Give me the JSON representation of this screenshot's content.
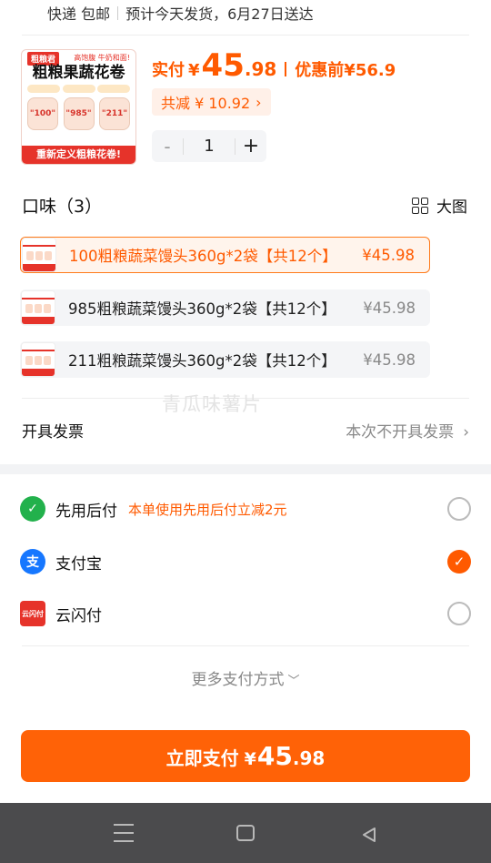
{
  "shipping": {
    "method": "快递 包邮",
    "estimate": "预计今天发货，6月27日送达"
  },
  "product": {
    "image": {
      "brand": "粗粮君",
      "tag": "高饱腹 牛奶和面!",
      "title": "粗粮果蔬花卷",
      "buns": [
        "\"100\"",
        "\"985\"",
        "\"211\""
      ],
      "footer": "重新定义粗粮花卷!"
    },
    "price_label": "实付",
    "price_currency": "¥",
    "price_int": "45",
    "price_dec": ".98",
    "orig_label": "优惠前",
    "orig_price": "¥56.9",
    "discount": "共减 ¥ 10.92",
    "quantity": "1",
    "minus": "-",
    "plus": "+"
  },
  "flavor": {
    "title": "口味（3）",
    "bigview": "大图",
    "options": [
      {
        "name": "100粗粮蔬菜馒头360g*2袋【共12个】",
        "price": "¥45.98"
      },
      {
        "name": "985粗粮蔬菜馒头360g*2袋【共12个】",
        "price": "¥45.98"
      },
      {
        "name": "211粗粮蔬菜馒头360g*2袋【共12个】",
        "price": "¥45.98"
      }
    ]
  },
  "watermark": "青瓜味薯片",
  "invoice": {
    "label": "开具发票",
    "value": "本次不开具发票"
  },
  "payment": {
    "methods": [
      {
        "name": "先用后付",
        "promo": "本单使用先用后付立减2元",
        "icon": "wallet-icon",
        "color": "#22b14c",
        "checked": false
      },
      {
        "name": "支付宝",
        "promo": "",
        "icon": "alipay-icon",
        "color": "#1677ff",
        "checked": true
      },
      {
        "name": "云闪付",
        "promo": "",
        "icon": "unionpay-icon",
        "color": "#e6332a",
        "checked": false
      }
    ],
    "icon_glyphs": {
      "alipay": "支",
      "unionpay": "云闪付",
      "wallet": "✓"
    },
    "more": "更多支付方式"
  },
  "pay_button": {
    "label": "立即支付",
    "currency": "¥",
    "int": "45",
    "dec": ".98"
  },
  "colors": {
    "accent": "#ff6207",
    "accent_text": "#ff5a00"
  }
}
